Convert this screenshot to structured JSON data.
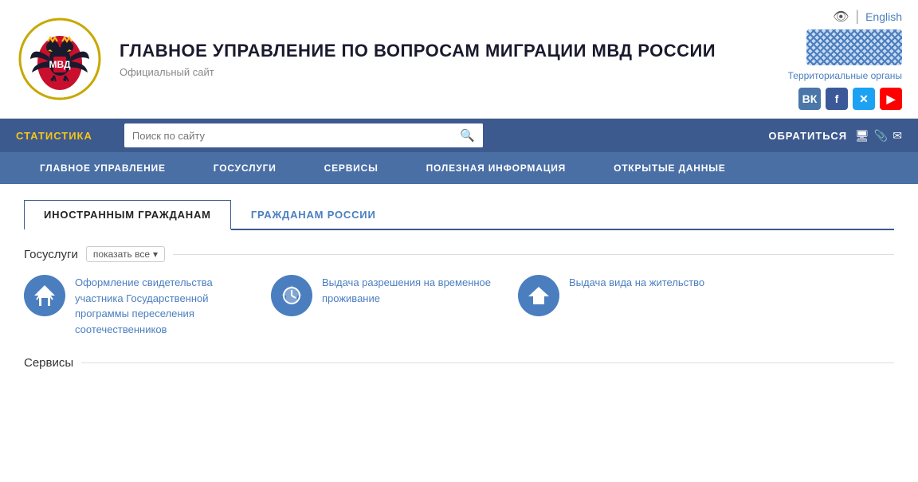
{
  "header": {
    "title": "ГЛАВНОЕ УПРАВЛЕНИЕ ПО ВОПРОСАМ МИГРАЦИИ МВД РОССИИ",
    "subtitle": "Официальный сайт",
    "lang_icon": "👁",
    "lang_sep": "|",
    "lang_link": "English",
    "region_link": "Территориальные органы",
    "social": [
      {
        "id": "vk",
        "label": "ВК",
        "class": "social-vk"
      },
      {
        "id": "fb",
        "label": "f",
        "class": "social-fb"
      },
      {
        "id": "tw",
        "label": "𝕏",
        "class": "social-tw"
      },
      {
        "id": "yt",
        "label": "▶",
        "class": "social-yt"
      }
    ]
  },
  "nav_top": {
    "stat_label": "СТАТИСТИКА",
    "search_placeholder": "Поиск по сайту",
    "contact_label": "ОБРАТИТЬСЯ",
    "icons": [
      "🖥",
      "📎",
      "✉"
    ]
  },
  "nav_main": {
    "items": [
      {
        "id": "main",
        "label": "ГЛАВНОЕ УПРАВЛЕНИЕ"
      },
      {
        "id": "gosuslugi",
        "label": "ГОСУСЛУГИ"
      },
      {
        "id": "services",
        "label": "СЕРВИСЫ"
      },
      {
        "id": "useful",
        "label": "ПОЛЕЗНАЯ ИНФОРМАЦИЯ"
      },
      {
        "id": "opendata",
        "label": "ОТКРЫТЫЕ ДАННЫЕ"
      }
    ]
  },
  "tabs": [
    {
      "id": "foreign",
      "label": "ИНОСТРАННЫМ ГРАЖДАНАМ",
      "active": true
    },
    {
      "id": "russian",
      "label": "ГРАЖДАНАМ РОССИИ",
      "active": false
    }
  ],
  "gosuslugi_section": {
    "heading": "Госуслуги",
    "show_all": "показать все",
    "services": [
      {
        "id": "service1",
        "icon": "↗🏠",
        "text": "Оформление свидетельства участника Государственной программы переселения соотечественников"
      },
      {
        "id": "service2",
        "icon": "↗🕐",
        "text": "Выдача разрешения на временное проживание"
      },
      {
        "id": "service3",
        "icon": "↗🏔",
        "text": "Выдача вида на жительство"
      }
    ]
  },
  "servisy_section": {
    "heading": "Сервисы"
  }
}
